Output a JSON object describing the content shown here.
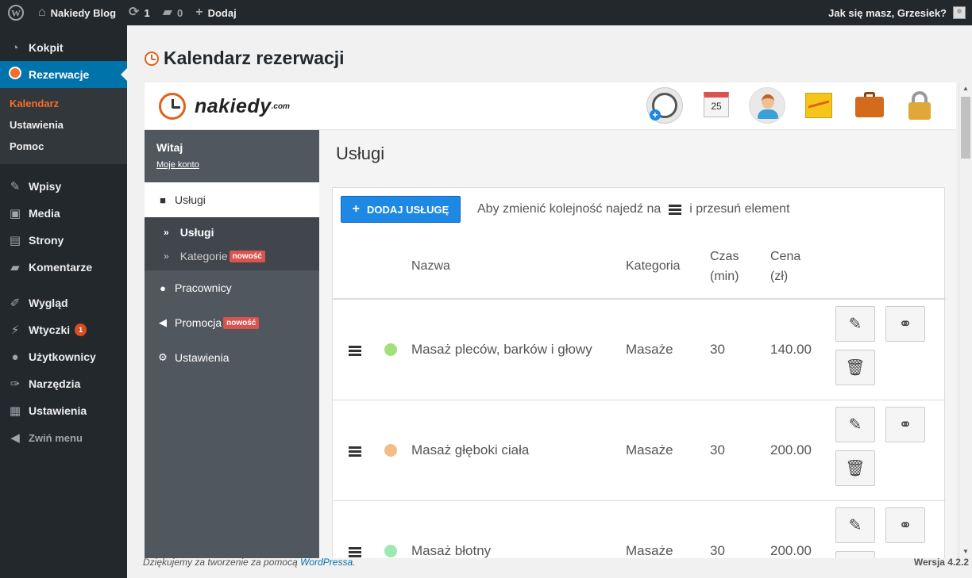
{
  "adminbar": {
    "site_name": "Nakiedy Blog",
    "updates_count": "1",
    "comments_count": "0",
    "new_label": "Dodaj",
    "greeting": "Jak się masz, Grzesiek?"
  },
  "wpmenu": {
    "items": [
      {
        "label": "Kokpit",
        "icon": "dashboard-icon"
      },
      {
        "label": "Rezerwacje",
        "icon": "clock-icon"
      },
      {
        "label": "Wpisy",
        "icon": "pin-icon"
      },
      {
        "label": "Media",
        "icon": "media-icon"
      },
      {
        "label": "Strony",
        "icon": "pages-icon"
      },
      {
        "label": "Komentarze",
        "icon": "comment-icon"
      },
      {
        "label": "Wygląd",
        "icon": "brush-icon"
      },
      {
        "label": "Wtyczki",
        "icon": "plugin-icon",
        "badge": "1"
      },
      {
        "label": "Użytkownicy",
        "icon": "user-icon"
      },
      {
        "label": "Narzędzia",
        "icon": "wrench-icon"
      },
      {
        "label": "Ustawienia",
        "icon": "settings-icon"
      }
    ],
    "submenu": [
      "Kalendarz",
      "Ustawienia",
      "Pomoc"
    ],
    "collapse_label": "Zwiń menu"
  },
  "page": {
    "title": "Kalendarz rezerwacji"
  },
  "plugin": {
    "logo_text": "nakiedy",
    "logo_suffix": ".com",
    "calendar_day": "25",
    "sidebar": {
      "welcome": "Witaj",
      "account_link": "Moje konto",
      "services": "Usługi",
      "sub_services": "Usługi",
      "sub_categories": "Kategorie",
      "new_badge": "nowość",
      "employees": "Pracownicy",
      "promotion": "Promocja",
      "settings": "Ustawienia"
    },
    "main": {
      "title": "Usługi",
      "add_button": "DODAJ USŁUGĘ",
      "hint_before": "Aby zmienić kolejność najedź na",
      "hint_after": "i przesuń element",
      "columns": {
        "name": "Nazwa",
        "category": "Kategoria",
        "time_line1": "Czas",
        "time_line2": "(min)",
        "price_line1": "Cena",
        "price_line2": "(zł)"
      },
      "rows": [
        {
          "name": "Masaż pleców, barków i głowy",
          "category": "Masaże",
          "time": "30",
          "price": "140.00",
          "color": "#a4e07a"
        },
        {
          "name": "Masaż głęboki ciała",
          "category": "Masaże",
          "time": "30",
          "price": "200.00",
          "color": "#f2bd88"
        },
        {
          "name": "Masaż błotny",
          "category": "Masaże",
          "time": "30",
          "price": "200.00",
          "color": "#9ee8b4"
        }
      ]
    }
  },
  "footer": {
    "thanks_before": "Dziękujemy za tworzenie za pomocą",
    "thanks_link": "WordPressa",
    "version": "Wersja 4.2.2"
  },
  "colors": {
    "accent": "#0073aa",
    "button": "#1e88e5",
    "badge": "#d9534f",
    "current": "#f56e28"
  }
}
